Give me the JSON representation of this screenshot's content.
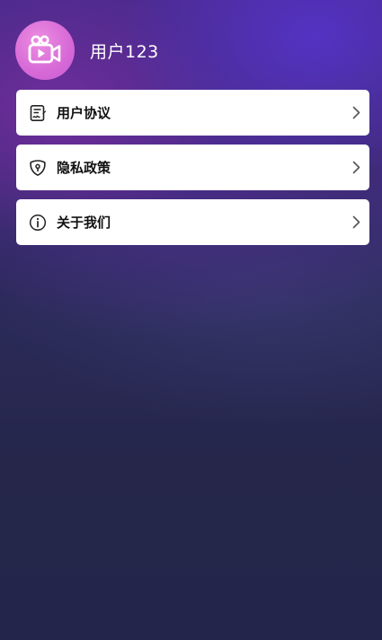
{
  "profile": {
    "username": "用户123",
    "avatar_icon": "video-camera-icon",
    "avatar_color": "#d769d7"
  },
  "menu": {
    "items": [
      {
        "label": "用户协议",
        "icon": "agreement-icon"
      },
      {
        "label": "隐私政策",
        "icon": "privacy-shield-icon"
      },
      {
        "label": "关于我们",
        "icon": "info-icon"
      }
    ],
    "chevron_icon": "chevron-right-icon"
  },
  "colors": {
    "card_background": "#ffffff",
    "text_primary": "#111111",
    "username_text": "#ffffff",
    "background_bottom": "#23254a",
    "background_top": "#4a2a8c"
  }
}
